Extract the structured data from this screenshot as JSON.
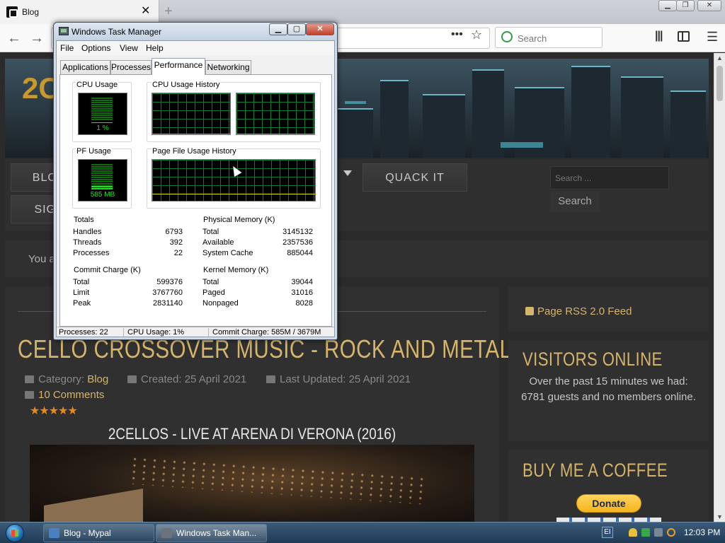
{
  "browser": {
    "tab_title": "Blog",
    "close_glyph": "✕",
    "newtab_glyph": "+",
    "back_glyph": "←",
    "forward_glyph": "→",
    "page_actions_glyph": "•••",
    "bookmark_glyph": "☆",
    "search_placeholder": "Search",
    "library_glyph": "|||",
    "menu_glyph": "☰",
    "window_min": "▁",
    "window_max": "❐",
    "window_close": "✕"
  },
  "site": {
    "logo": "2C",
    "nav": [
      {
        "label": "BLOG"
      },
      {
        "label": "QUACK IT"
      },
      {
        "label": "SIGN"
      }
    ],
    "search_placeholder": "Search ...",
    "search_button": "Search",
    "breadcrumb": "You a",
    "article": {
      "title": "CELLO CROSSOVER MUSIC - ROCK AND METAL",
      "category_label": "Category:",
      "category_value": "Blog",
      "created": "Created: 25 April 2021",
      "updated": "Last Updated: 25 April 2021",
      "comments": "10 Comments",
      "stars": "★★★★★",
      "rating": 5,
      "video_title": "2CELLOS - LIVE AT ARENA DI VERONA (2016)"
    },
    "sidebar": {
      "rss": "Page RSS 2.0 Feed",
      "visitors_title": "VISITORS ONLINE",
      "visitors_text": "Over the past 15 minutes we had: 6781 guests and no members online.",
      "coffee_title": "BUY ME A COFFEE",
      "donate": "Donate"
    }
  },
  "taskmanager": {
    "title": "Windows Task Manager",
    "controls": {
      "min": "▁",
      "max": "▢",
      "close": "✕"
    },
    "menu": [
      "File",
      "Options",
      "View",
      "Help"
    ],
    "tabs": [
      "Applications",
      "Processes",
      "Performance",
      "Networking"
    ],
    "active_tab": "Performance",
    "cpu_usage_label": "CPU Usage",
    "cpu_usage_value": "1 %",
    "cpu_usage_fraction": 0.01,
    "cpu_history_label": "CPU Usage History",
    "pf_usage_label": "PF Usage",
    "pf_usage_value": "585 MB",
    "pf_usage_fraction": 0.16,
    "pf_history_label": "Page File Usage History",
    "totals": {
      "label": "Totals",
      "rows": [
        {
          "k": "Handles",
          "v": "6793"
        },
        {
          "k": "Threads",
          "v": "392"
        },
        {
          "k": "Processes",
          "v": "22"
        }
      ]
    },
    "physical": {
      "label": "Physical Memory (K)",
      "rows": [
        {
          "k": "Total",
          "v": "3145132"
        },
        {
          "k": "Available",
          "v": "2357536"
        },
        {
          "k": "System Cache",
          "v": "885044"
        }
      ]
    },
    "commit": {
      "label": "Commit Charge (K)",
      "rows": [
        {
          "k": "Total",
          "v": "599376"
        },
        {
          "k": "Limit",
          "v": "3767760"
        },
        {
          "k": "Peak",
          "v": "2831140"
        }
      ]
    },
    "kernel": {
      "label": "Kernel Memory (K)",
      "rows": [
        {
          "k": "Total",
          "v": "39044"
        },
        {
          "k": "Paged",
          "v": "31016"
        },
        {
          "k": "Nonpaged",
          "v": "8028"
        }
      ]
    },
    "status": {
      "processes": "Processes: 22",
      "cpu": "CPU Usage: 1%",
      "commit": "Commit Charge: 585M / 3679M"
    }
  },
  "taskbar": {
    "buttons": [
      {
        "label": "Blog - Mypal",
        "icon_color": "#4a7fc1"
      },
      {
        "label": "Windows Task Man...",
        "icon_color": "#6b737c"
      }
    ],
    "lang": "EI",
    "clock": "12:03 PM"
  }
}
